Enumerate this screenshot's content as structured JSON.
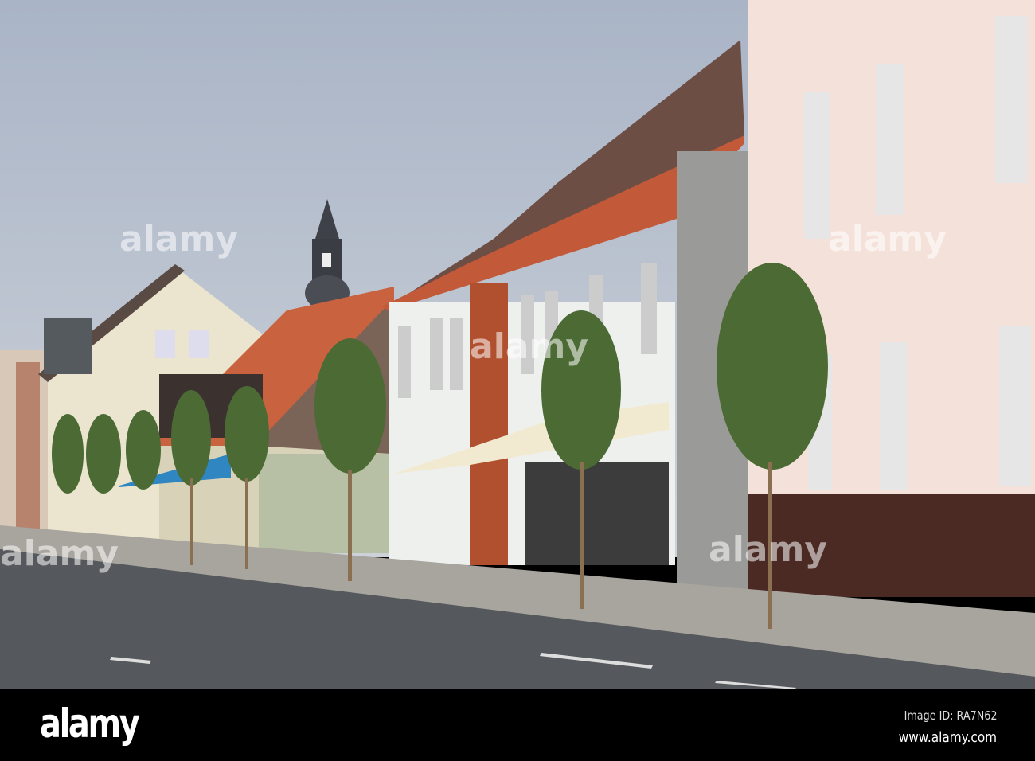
{
  "photo": {
    "description_subject": "street-scene",
    "watermark_text": "alamy",
    "colors": {
      "sky": "#b4bfcf",
      "pink_facade": "#f4e2da",
      "brick_base": "#4b2a24",
      "white_house": "#eef0ee",
      "roof_tile": "#b8583a",
      "road": "#55585c"
    }
  },
  "footer": {
    "logo": "alamy",
    "image_id": "Image ID: RA7N62",
    "url": "www.alamy.com"
  }
}
